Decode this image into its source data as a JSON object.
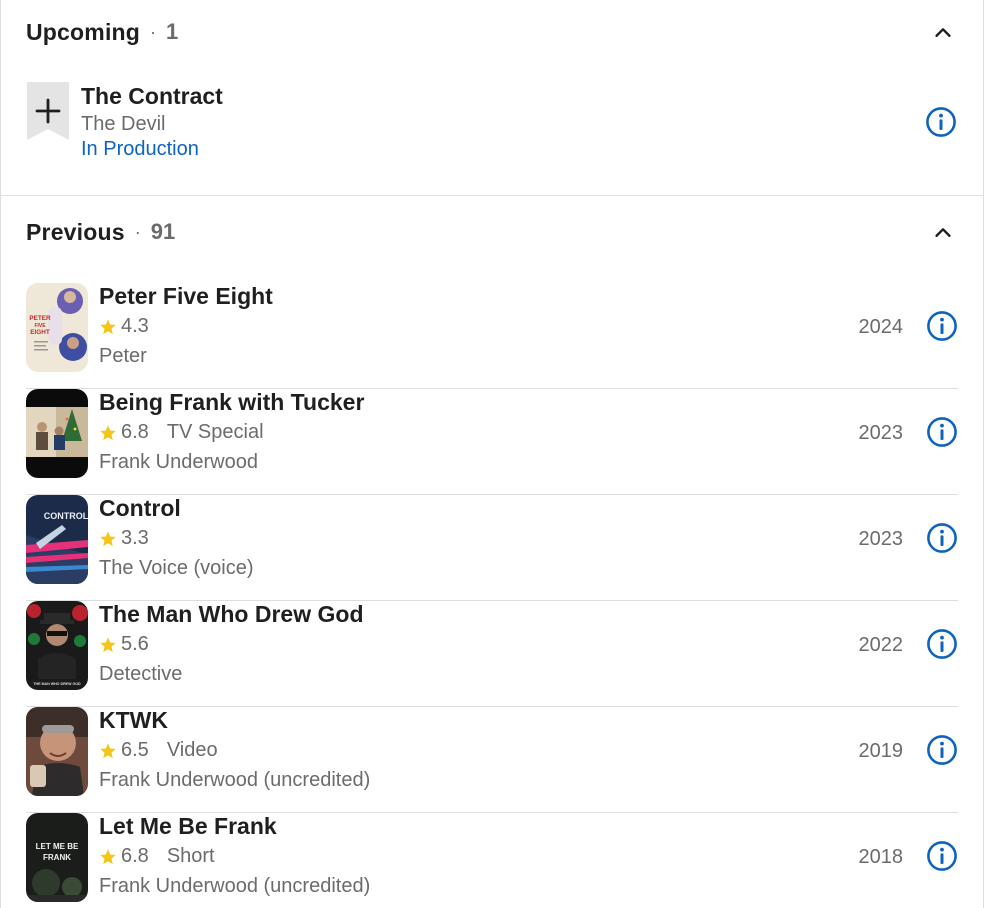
{
  "upcoming": {
    "title": "Upcoming",
    "separator": "·",
    "count": "1",
    "items": [
      {
        "title": "The Contract",
        "role": "The Devil",
        "status": "In Production"
      }
    ]
  },
  "previous": {
    "title": "Previous",
    "separator": "·",
    "count": "91",
    "items": [
      {
        "title": "Peter Five Eight",
        "rating": "4.3",
        "kind": "",
        "role": "Peter",
        "year": "2024",
        "poster_lettering": [
          "PETER",
          "FIVE",
          "EIGHT"
        ]
      },
      {
        "title": "Being Frank with Tucker",
        "rating": "6.8",
        "kind": "TV Special",
        "role": "Frank Underwood",
        "year": "2023"
      },
      {
        "title": "Control",
        "rating": "3.3",
        "kind": "",
        "role": "The Voice (voice)",
        "year": "2023",
        "poster_lettering": [
          "CONTROL"
        ]
      },
      {
        "title": "The Man Who Drew God",
        "rating": "5.6",
        "kind": "",
        "role": "Detective",
        "year": "2022",
        "poster_lettering": [
          "THE MAN WHO DREW GOD"
        ]
      },
      {
        "title": "KTWK",
        "rating": "6.5",
        "kind": "Video",
        "role": "Frank Underwood (uncredited)",
        "year": "2019"
      },
      {
        "title": "Let Me Be Frank",
        "rating": "6.8",
        "kind": "Short",
        "role": "Frank Underwood (uncredited)",
        "year": "2018",
        "poster_lettering": [
          "LET ME BE",
          "FRANK"
        ]
      }
    ]
  },
  "colors": {
    "accent_blue": "#0e63be",
    "star": "#f5c518",
    "text": "#1f1f1f",
    "muted": "#6b6b6b",
    "divider": "#dedede"
  },
  "icons": [
    "chevron-up-icon",
    "add-to-watchlist-icon",
    "info-icon",
    "star-icon"
  ]
}
